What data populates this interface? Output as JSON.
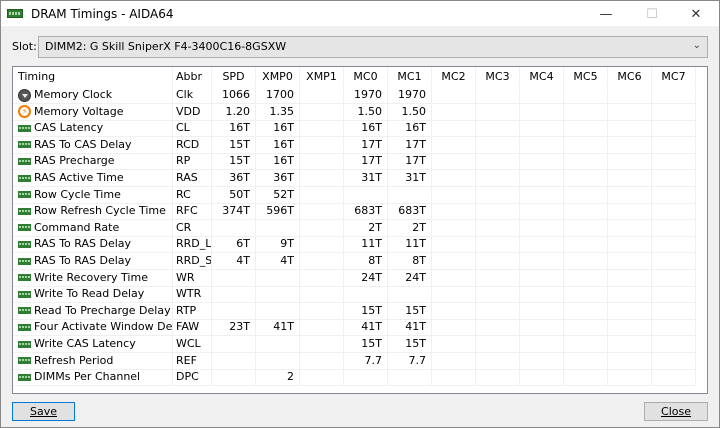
{
  "window": {
    "title": "DRAM Timings - AIDA64",
    "minimize": "—",
    "maximize": "☐",
    "close": "✕"
  },
  "slot": {
    "label": "Slot:",
    "value": "DIMM2: G Skill SniperX F4-3400C16-8GSXW"
  },
  "columns": [
    "Timing",
    "Abbr",
    "SPD",
    "XMP0",
    "XMP1",
    "MC0",
    "MC1",
    "MC2",
    "MC3",
    "MC4",
    "MC5",
    "MC6",
    "MC7"
  ],
  "rows": [
    {
      "icon": "clock-icon",
      "name": "Memory Clock",
      "abbr": "Clk",
      "v": [
        "1066",
        "1700",
        "",
        "1970",
        "1970",
        "",
        "",
        "",
        "",
        "",
        ""
      ]
    },
    {
      "icon": "voltage-icon",
      "name": "Memory Voltage",
      "abbr": "VDD",
      "v": [
        "1.20",
        "1.35",
        "",
        "1.50",
        "1.50",
        "",
        "",
        "",
        "",
        "",
        ""
      ]
    },
    {
      "icon": "ram-icon",
      "name": "CAS Latency",
      "abbr": "CL",
      "v": [
        "16T",
        "16T",
        "",
        "16T",
        "16T",
        "",
        "",
        "",
        "",
        "",
        ""
      ]
    },
    {
      "icon": "ram-icon",
      "name": "RAS To CAS Delay",
      "abbr": "RCD",
      "v": [
        "15T",
        "16T",
        "",
        "17T",
        "17T",
        "",
        "",
        "",
        "",
        "",
        ""
      ]
    },
    {
      "icon": "ram-icon",
      "name": "RAS Precharge",
      "abbr": "RP",
      "v": [
        "15T",
        "16T",
        "",
        "17T",
        "17T",
        "",
        "",
        "",
        "",
        "",
        ""
      ]
    },
    {
      "icon": "ram-icon",
      "name": "RAS Active Time",
      "abbr": "RAS",
      "v": [
        "36T",
        "36T",
        "",
        "31T",
        "31T",
        "",
        "",
        "",
        "",
        "",
        ""
      ]
    },
    {
      "icon": "ram-icon",
      "name": "Row Cycle Time",
      "abbr": "RC",
      "v": [
        "50T",
        "52T",
        "",
        "",
        "",
        "",
        "",
        "",
        "",
        "",
        ""
      ]
    },
    {
      "icon": "ram-icon",
      "name": "Row Refresh Cycle Time",
      "abbr": "RFC",
      "v": [
        "374T",
        "596T",
        "",
        "683T",
        "683T",
        "",
        "",
        "",
        "",
        "",
        ""
      ]
    },
    {
      "icon": "ram-icon",
      "name": "Command Rate",
      "abbr": "CR",
      "v": [
        "",
        "",
        "",
        "2T",
        "2T",
        "",
        "",
        "",
        "",
        "",
        ""
      ]
    },
    {
      "icon": "ram-icon",
      "name": "RAS To RAS Delay",
      "abbr": "RRD_L",
      "v": [
        "6T",
        "9T",
        "",
        "11T",
        "11T",
        "",
        "",
        "",
        "",
        "",
        ""
      ]
    },
    {
      "icon": "ram-icon",
      "name": "RAS To RAS Delay",
      "abbr": "RRD_S",
      "v": [
        "4T",
        "4T",
        "",
        "8T",
        "8T",
        "",
        "",
        "",
        "",
        "",
        ""
      ]
    },
    {
      "icon": "ram-icon",
      "name": "Write Recovery Time",
      "abbr": "WR",
      "v": [
        "",
        "",
        "",
        "24T",
        "24T",
        "",
        "",
        "",
        "",
        "",
        ""
      ]
    },
    {
      "icon": "ram-icon",
      "name": "Write To Read Delay",
      "abbr": "WTR",
      "v": [
        "",
        "",
        "",
        "",
        "",
        "",
        "",
        "",
        "",
        "",
        ""
      ]
    },
    {
      "icon": "ram-icon",
      "name": "Read To Precharge Delay",
      "abbr": "RTP",
      "v": [
        "",
        "",
        "",
        "15T",
        "15T",
        "",
        "",
        "",
        "",
        "",
        ""
      ]
    },
    {
      "icon": "ram-icon",
      "name": "Four Activate Window Delay",
      "abbr": "FAW",
      "v": [
        "23T",
        "41T",
        "",
        "41T",
        "41T",
        "",
        "",
        "",
        "",
        "",
        ""
      ]
    },
    {
      "icon": "ram-icon",
      "name": "Write CAS Latency",
      "abbr": "WCL",
      "v": [
        "",
        "",
        "",
        "15T",
        "15T",
        "",
        "",
        "",
        "",
        "",
        ""
      ]
    },
    {
      "icon": "ram-icon",
      "name": "Refresh Period",
      "abbr": "REF",
      "v": [
        "",
        "",
        "",
        "7.7",
        "7.7",
        "",
        "",
        "",
        "",
        "",
        ""
      ]
    },
    {
      "icon": "ram-icon",
      "name": "DIMMs Per Channel",
      "abbr": "DPC",
      "v": [
        "",
        "2",
        "",
        "",
        "",
        "",
        "",
        "",
        "",
        "",
        ""
      ]
    }
  ],
  "buttons": {
    "save": "Save",
    "close": "Close"
  }
}
